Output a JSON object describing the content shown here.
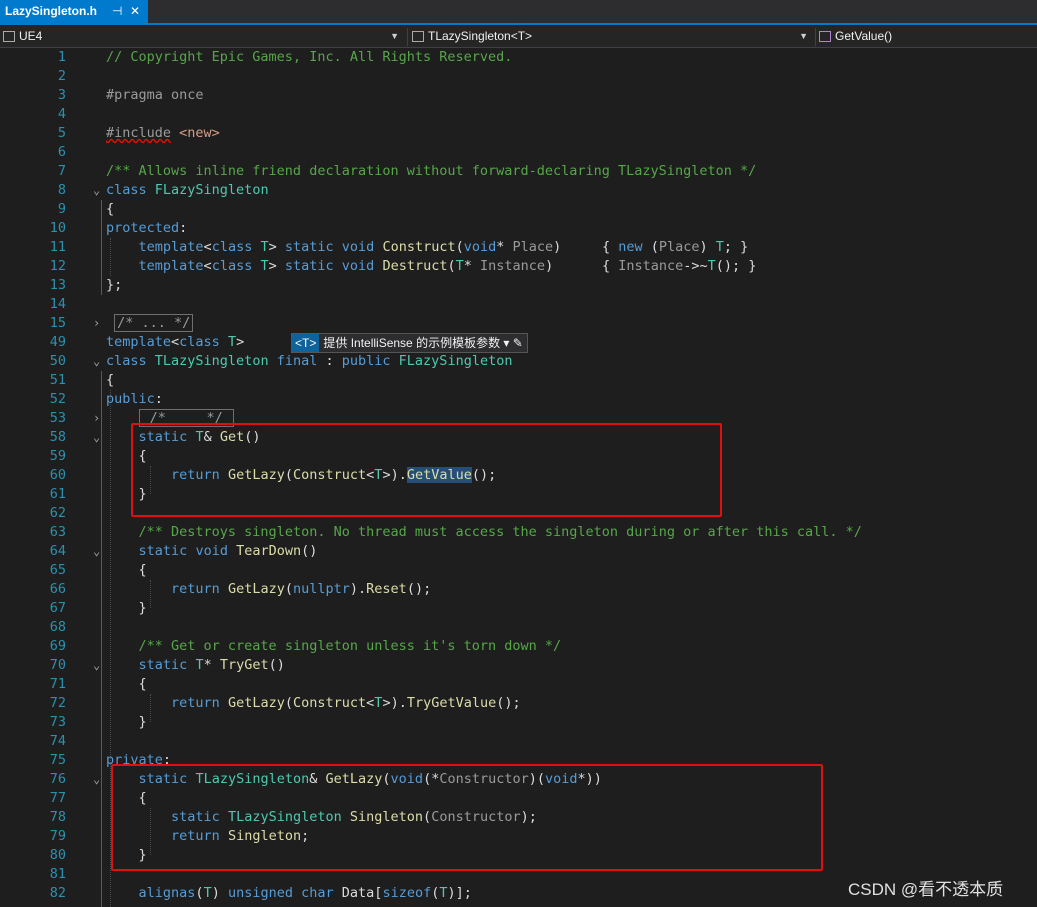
{
  "tab": {
    "title": "LazySingleton.h",
    "pin": "⊣",
    "close": "✕"
  },
  "navbar": {
    "project": "UE4",
    "scope": "TLazySingleton<T>",
    "member": "GetValue()"
  },
  "hint": {
    "tag": "<T>",
    "text": "提供 IntelliSense 的示例模板参数"
  },
  "watermark": "CSDN @看不透本质",
  "colors": {
    "accent": "#007acc",
    "highlight_box": "#e01010",
    "comment": "#57a64a",
    "keyword": "#569cd6",
    "function": "#dcdcaa"
  },
  "lines": [
    {
      "n": "1",
      "f": "",
      "c": [
        [
          "c-com",
          "// Copyright Epic Games, Inc. All Rights Reserved."
        ]
      ]
    },
    {
      "n": "2",
      "f": "",
      "c": []
    },
    {
      "n": "3",
      "f": "",
      "c": [
        [
          "c-pp",
          "#pragma once"
        ]
      ]
    },
    {
      "n": "4",
      "f": "",
      "c": []
    },
    {
      "n": "5",
      "f": "",
      "c": [
        [
          "c-pp wavy",
          "#include"
        ],
        [
          "c-id",
          " "
        ],
        [
          "c-str",
          "<new>"
        ]
      ]
    },
    {
      "n": "6",
      "f": "",
      "c": []
    },
    {
      "n": "7",
      "f": "",
      "c": [
        [
          "c-com",
          "/** Allows inline friend declaration without forward-declaring TLazySingleton */"
        ]
      ]
    },
    {
      "n": "8",
      "f": "⌄",
      "c": [
        [
          "c-kw",
          "class"
        ],
        [
          "c-id",
          " "
        ],
        [
          "c-ty",
          "FLazySingleton"
        ]
      ]
    },
    {
      "n": "9",
      "f": "",
      "c": [
        [
          "c-id",
          "{"
        ]
      ]
    },
    {
      "n": "10",
      "f": "",
      "c": [
        [
          "c-kw",
          "protected"
        ],
        [
          "c-id",
          ":"
        ]
      ]
    },
    {
      "n": "11",
      "f": "",
      "c": [
        [
          "c-id",
          "    "
        ],
        [
          "c-kw",
          "template"
        ],
        [
          "c-id",
          "<"
        ],
        [
          "c-kw",
          "class"
        ],
        [
          "c-id",
          " "
        ],
        [
          "c-ty",
          "T"
        ],
        [
          "c-id",
          "> "
        ],
        [
          "c-kw",
          "static"
        ],
        [
          "c-id",
          " "
        ],
        [
          "c-kw",
          "void"
        ],
        [
          "c-id",
          " "
        ],
        [
          "c-fn",
          "Construct"
        ],
        [
          "c-id",
          "("
        ],
        [
          "c-kw",
          "void"
        ],
        [
          "c-id",
          "* "
        ],
        [
          "c-pa",
          "Place"
        ],
        [
          "c-id",
          ")     { "
        ],
        [
          "c-kw",
          "new"
        ],
        [
          "c-id",
          " ("
        ],
        [
          "c-pa",
          "Place"
        ],
        [
          "c-id",
          ") "
        ],
        [
          "c-ty",
          "T"
        ],
        [
          "c-id",
          "; }"
        ]
      ]
    },
    {
      "n": "12",
      "f": "",
      "c": [
        [
          "c-id",
          "    "
        ],
        [
          "c-kw",
          "template"
        ],
        [
          "c-id",
          "<"
        ],
        [
          "c-kw",
          "class"
        ],
        [
          "c-id",
          " "
        ],
        [
          "c-ty",
          "T"
        ],
        [
          "c-id",
          "> "
        ],
        [
          "c-kw",
          "static"
        ],
        [
          "c-id",
          " "
        ],
        [
          "c-kw",
          "void"
        ],
        [
          "c-id",
          " "
        ],
        [
          "c-fn",
          "Destruct"
        ],
        [
          "c-id",
          "("
        ],
        [
          "c-ty",
          "T"
        ],
        [
          "c-id",
          "* "
        ],
        [
          "c-pa",
          "Instance"
        ],
        [
          "c-id",
          ")      { "
        ],
        [
          "c-pa",
          "Instance"
        ],
        [
          "c-id",
          "->~"
        ],
        [
          "c-ty",
          "T"
        ],
        [
          "c-id",
          "(); }"
        ]
      ]
    },
    {
      "n": "13",
      "f": "",
      "c": [
        [
          "c-id",
          "};"
        ]
      ]
    },
    {
      "n": "14",
      "f": "",
      "c": []
    },
    {
      "n": "15",
      "f": "›",
      "c": [
        [
          "c-id",
          " "
        ],
        [
          "collapsed",
          "/* ... */"
        ]
      ]
    },
    {
      "n": "49",
      "f": "",
      "c": [
        [
          "c-kw",
          "template"
        ],
        [
          "c-id",
          "<"
        ],
        [
          "c-kw",
          "class"
        ],
        [
          "c-id",
          " "
        ],
        [
          "c-ty",
          "T"
        ],
        [
          "c-id",
          ">"
        ]
      ]
    },
    {
      "n": "50",
      "f": "⌄",
      "c": [
        [
          "c-kw",
          "class"
        ],
        [
          "c-id",
          " "
        ],
        [
          "c-ty",
          "TLazySingleton"
        ],
        [
          "c-id",
          " "
        ],
        [
          "c-kw",
          "final"
        ],
        [
          "c-id",
          " : "
        ],
        [
          "c-kw",
          "public"
        ],
        [
          "c-id",
          " "
        ],
        [
          "c-ty",
          "FLazySingleton"
        ]
      ]
    },
    {
      "n": "51",
      "f": "",
      "c": [
        [
          "c-id",
          "{"
        ]
      ]
    },
    {
      "n": "52",
      "f": "",
      "c": [
        [
          "c-kw",
          "public"
        ],
        [
          "c-id",
          ":"
        ]
      ]
    },
    {
      "n": "53",
      "f": "›",
      "c": [
        [
          "c-id",
          "    "
        ],
        [
          "collapsed",
          " /*     */ "
        ]
      ]
    },
    {
      "n": "58",
      "f": "⌄",
      "c": [
        [
          "c-id",
          "    "
        ],
        [
          "c-kw",
          "static"
        ],
        [
          "c-id",
          " "
        ],
        [
          "c-ty",
          "T"
        ],
        [
          "c-id",
          "& "
        ],
        [
          "c-fn",
          "Get"
        ],
        [
          "c-id",
          "()"
        ]
      ]
    },
    {
      "n": "59",
      "f": "",
      "c": [
        [
          "c-id",
          "    {"
        ]
      ]
    },
    {
      "n": "60",
      "f": "",
      "c": [
        [
          "c-id",
          "        "
        ],
        [
          "c-kw",
          "return"
        ],
        [
          "c-id",
          " "
        ],
        [
          "c-fn",
          "GetLazy"
        ],
        [
          "c-id",
          "("
        ],
        [
          "c-fn",
          "Construct"
        ],
        [
          "c-id",
          "<"
        ],
        [
          "c-ty",
          "T"
        ],
        [
          "c-id",
          ">)."
        ],
        [
          "c-sel",
          "GetValue"
        ],
        [
          "c-id",
          "();"
        ]
      ]
    },
    {
      "n": "61",
      "f": "",
      "c": [
        [
          "c-id",
          "    }"
        ]
      ]
    },
    {
      "n": "62",
      "f": "",
      "c": []
    },
    {
      "n": "63",
      "f": "",
      "c": [
        [
          "c-id",
          "    "
        ],
        [
          "c-com",
          "/** Destroys singleton. No thread must access the singleton during or after this call. */"
        ]
      ]
    },
    {
      "n": "64",
      "f": "⌄",
      "c": [
        [
          "c-id",
          "    "
        ],
        [
          "c-kw",
          "static"
        ],
        [
          "c-id",
          " "
        ],
        [
          "c-kw",
          "void"
        ],
        [
          "c-id",
          " "
        ],
        [
          "c-fn",
          "TearDown"
        ],
        [
          "c-id",
          "()"
        ]
      ]
    },
    {
      "n": "65",
      "f": "",
      "c": [
        [
          "c-id",
          "    {"
        ]
      ]
    },
    {
      "n": "66",
      "f": "",
      "c": [
        [
          "c-id",
          "        "
        ],
        [
          "c-kw",
          "return"
        ],
        [
          "c-id",
          " "
        ],
        [
          "c-fn",
          "GetLazy"
        ],
        [
          "c-id",
          "("
        ],
        [
          "c-kw",
          "nullptr"
        ],
        [
          "c-id",
          ")."
        ],
        [
          "c-fn",
          "Reset"
        ],
        [
          "c-id",
          "();"
        ]
      ]
    },
    {
      "n": "67",
      "f": "",
      "c": [
        [
          "c-id",
          "    }"
        ]
      ]
    },
    {
      "n": "68",
      "f": "",
      "c": []
    },
    {
      "n": "69",
      "f": "",
      "c": [
        [
          "c-id",
          "    "
        ],
        [
          "c-com",
          "/** Get or create singleton unless it's torn down */"
        ]
      ]
    },
    {
      "n": "70",
      "f": "⌄",
      "c": [
        [
          "c-id",
          "    "
        ],
        [
          "c-kw",
          "static"
        ],
        [
          "c-id",
          " "
        ],
        [
          "c-ty",
          "T"
        ],
        [
          "c-id",
          "* "
        ],
        [
          "c-fn",
          "TryGet"
        ],
        [
          "c-id",
          "()"
        ]
      ]
    },
    {
      "n": "71",
      "f": "",
      "c": [
        [
          "c-id",
          "    {"
        ]
      ]
    },
    {
      "n": "72",
      "f": "",
      "c": [
        [
          "c-id",
          "        "
        ],
        [
          "c-kw",
          "return"
        ],
        [
          "c-id",
          " "
        ],
        [
          "c-fn",
          "GetLazy"
        ],
        [
          "c-id",
          "("
        ],
        [
          "c-fn",
          "Construct"
        ],
        [
          "c-id",
          "<"
        ],
        [
          "c-ty",
          "T"
        ],
        [
          "c-id",
          ">)."
        ],
        [
          "c-fn",
          "TryGetValue"
        ],
        [
          "c-id",
          "();"
        ]
      ]
    },
    {
      "n": "73",
      "f": "",
      "c": [
        [
          "c-id",
          "    }"
        ]
      ]
    },
    {
      "n": "74",
      "f": "",
      "c": []
    },
    {
      "n": "75",
      "f": "",
      "c": [
        [
          "c-kw",
          "private"
        ],
        [
          "c-id",
          ":"
        ]
      ]
    },
    {
      "n": "76",
      "f": "⌄",
      "c": [
        [
          "c-id",
          "    "
        ],
        [
          "c-kw",
          "static"
        ],
        [
          "c-id",
          " "
        ],
        [
          "c-ty",
          "TLazySingleton"
        ],
        [
          "c-id",
          "& "
        ],
        [
          "c-fn",
          "GetLazy"
        ],
        [
          "c-id",
          "("
        ],
        [
          "c-kw",
          "void"
        ],
        [
          "c-id",
          "(*"
        ],
        [
          "c-pa",
          "Constructor"
        ],
        [
          "c-id",
          ")("
        ],
        [
          "c-kw",
          "void"
        ],
        [
          "c-id",
          "*))"
        ]
      ]
    },
    {
      "n": "77",
      "f": "",
      "c": [
        [
          "c-id",
          "    {"
        ]
      ]
    },
    {
      "n": "78",
      "f": "",
      "c": [
        [
          "c-id",
          "        "
        ],
        [
          "c-kw",
          "static"
        ],
        [
          "c-id",
          " "
        ],
        [
          "c-ty",
          "TLazySingleton"
        ],
        [
          "c-id",
          " "
        ],
        [
          "c-fn",
          "Singleton"
        ],
        [
          "c-id",
          "("
        ],
        [
          "c-pa",
          "Constructor"
        ],
        [
          "c-id",
          ");"
        ]
      ]
    },
    {
      "n": "79",
      "f": "",
      "c": [
        [
          "c-id",
          "        "
        ],
        [
          "c-kw",
          "return"
        ],
        [
          "c-id",
          " "
        ],
        [
          "c-fn",
          "Singleton"
        ],
        [
          "c-id",
          ";"
        ]
      ]
    },
    {
      "n": "80",
      "f": "",
      "c": [
        [
          "c-id",
          "    }"
        ]
      ]
    },
    {
      "n": "81",
      "f": "",
      "c": []
    },
    {
      "n": "82",
      "f": "",
      "c": [
        [
          "c-id",
          "    "
        ],
        [
          "c-kw",
          "alignas"
        ],
        [
          "c-id",
          "("
        ],
        [
          "c-ty",
          "T"
        ],
        [
          "c-id",
          ") "
        ],
        [
          "c-kw",
          "unsigned"
        ],
        [
          "c-id",
          " "
        ],
        [
          "c-kw",
          "char"
        ],
        [
          "c-id",
          " "
        ],
        [
          "c-id",
          "Data["
        ],
        [
          "c-kw",
          "sizeof"
        ],
        [
          "c-id",
          "("
        ],
        [
          "c-ty",
          "T"
        ],
        [
          "c-id",
          ")];"
        ]
      ]
    }
  ]
}
